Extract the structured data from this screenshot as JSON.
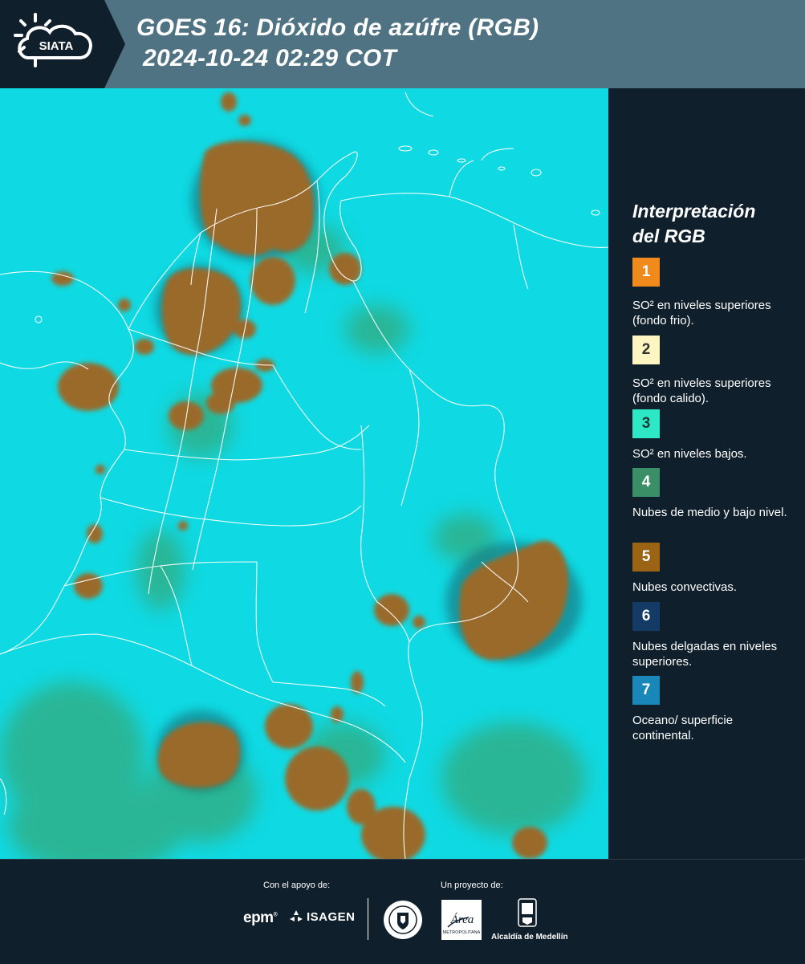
{
  "header": {
    "logo_text": "SIATA",
    "title_line1": "GOES 16: Dióxido de azúfre (RGB)",
    "title_line2": "2024-10-24 02:29 COT"
  },
  "legend": {
    "title_line1": "Interpretación",
    "title_line2": "del RGB",
    "items": [
      {
        "number": "1",
        "color": "#f08a1c",
        "text_color": "#ffffff",
        "description": "SO² en niveles superiores (fondo frio)."
      },
      {
        "number": "2",
        "color": "#fdf5c2",
        "text_color": "#333333",
        "description": "SO² en niveles superiores (fondo calido)."
      },
      {
        "number": "3",
        "color": "#2ee8c5",
        "text_color": "#1a3a3a",
        "description": "SO² en niveles bajos."
      },
      {
        "number": "4",
        "color": "#3a8f66",
        "text_color": "#ffffff",
        "description": "Nubes de medio y bajo nivel."
      },
      {
        "number": "5",
        "color": "#9a6414",
        "text_color": "#ffffff",
        "description": "Nubes convectivas."
      },
      {
        "number": "6",
        "color": "#143a66",
        "text_color": "#ffffff",
        "description": "Nubes delgadas en niveles superiores."
      },
      {
        "number": "7",
        "color": "#1987b8",
        "text_color": "#ffffff",
        "description": "Oceano/ superficie continental."
      }
    ]
  },
  "footer": {
    "support_label": "Con el apoyo de:",
    "project_label": "Un proyecto de:",
    "epm_text": "epm",
    "isagen_text": "ISAGEN",
    "area_text": "Área",
    "area_subtext": "METROPOLITANA",
    "alcaldia_text": "Alcaldía de Medellín"
  },
  "map": {
    "background_color": "#0fd9e2",
    "convective_color": "#9a6a2a",
    "low_cloud_color": "#3f9a5a",
    "border_color": "#ffffff"
  }
}
